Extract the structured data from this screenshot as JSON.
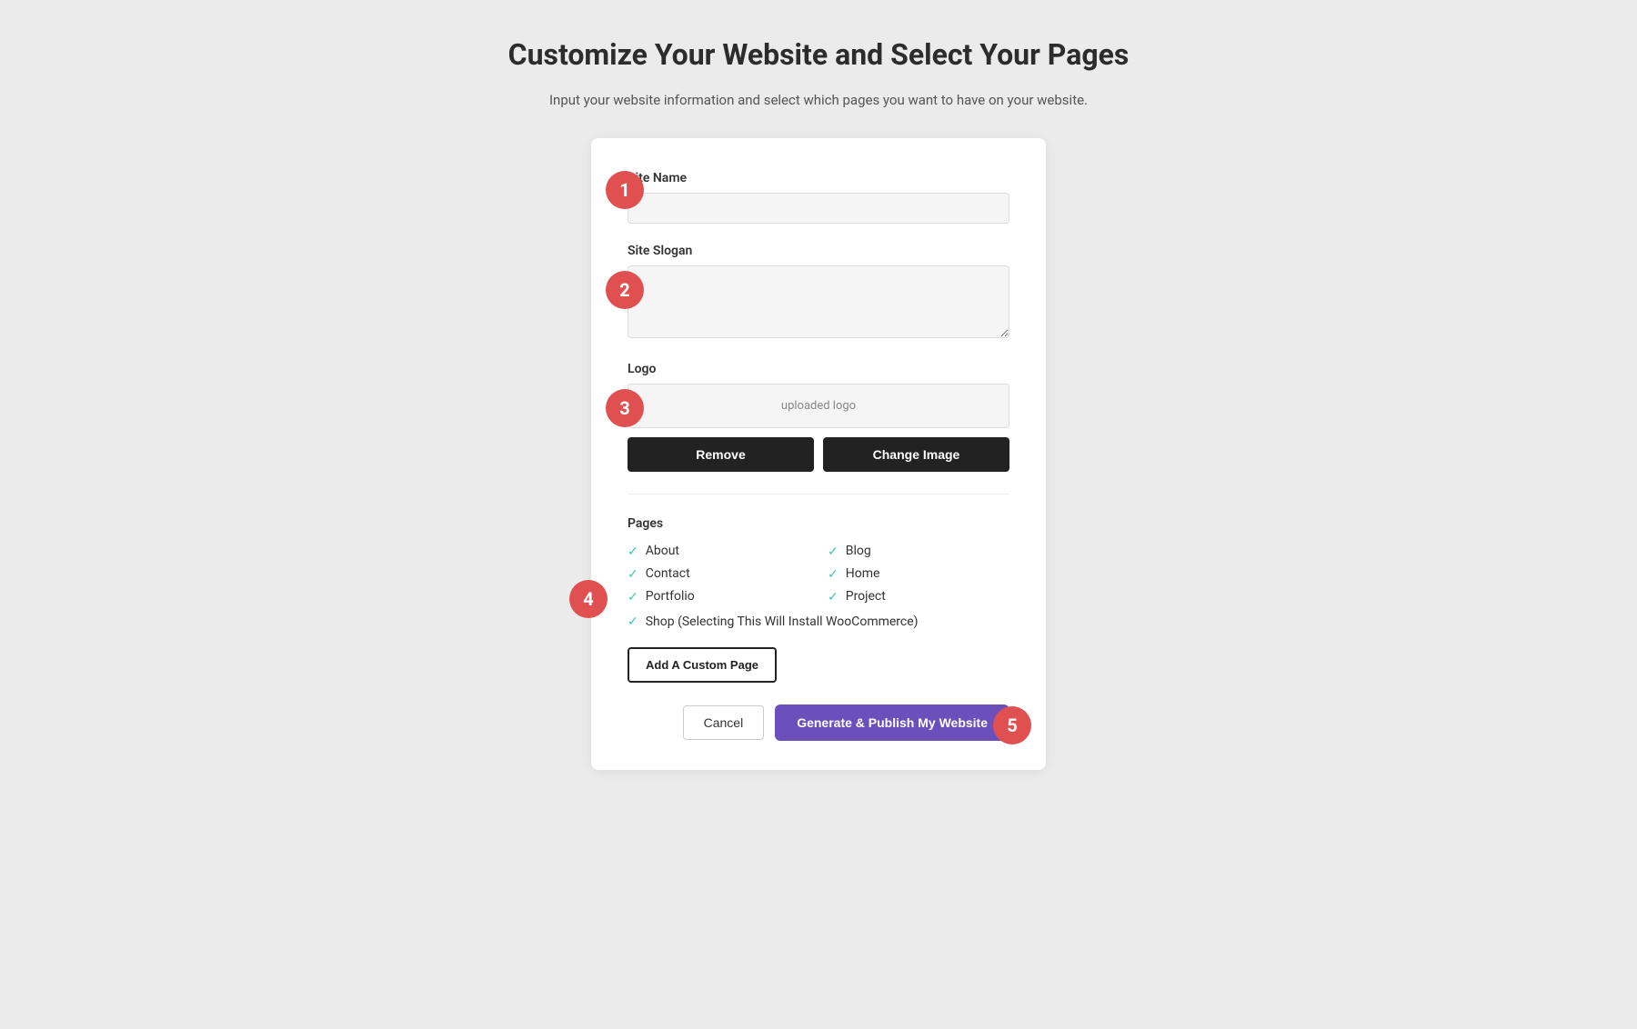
{
  "header": {
    "title": "Customize Your Website and Select Your Pages",
    "subtitle": "Input your website information and select which pages you want to have on your website."
  },
  "form": {
    "site_name_label": "Site Name",
    "site_name_placeholder": "",
    "site_slogan_label": "Site Slogan",
    "site_slogan_placeholder": "",
    "logo_label": "Logo",
    "logo_preview_text": "uploaded logo",
    "remove_button": "Remove",
    "change_image_button": "Change Image",
    "pages_label": "Pages",
    "pages": [
      {
        "label": "About",
        "checked": true,
        "col": 1
      },
      {
        "label": "Blog",
        "checked": true,
        "col": 2
      },
      {
        "label": "Contact",
        "checked": true,
        "col": 1
      },
      {
        "label": "Home",
        "checked": true,
        "col": 2
      },
      {
        "label": "Portfolio",
        "checked": true,
        "col": 1
      },
      {
        "label": "Project",
        "checked": true,
        "col": 2
      }
    ],
    "shop_label": "Shop (Selecting This Will Install WooCommerce)",
    "shop_checked": true,
    "add_custom_page_button": "Add A Custom Page",
    "cancel_button": "Cancel",
    "publish_button": "Generate & Publish My Website"
  },
  "steps": {
    "step1": "1",
    "step2": "2",
    "step3": "3",
    "step4": "4",
    "step5": "5"
  },
  "colors": {
    "badge_bg": "#E05050",
    "check_color": "#3DC9B0",
    "publish_btn_bg": "#6B4FBB"
  }
}
